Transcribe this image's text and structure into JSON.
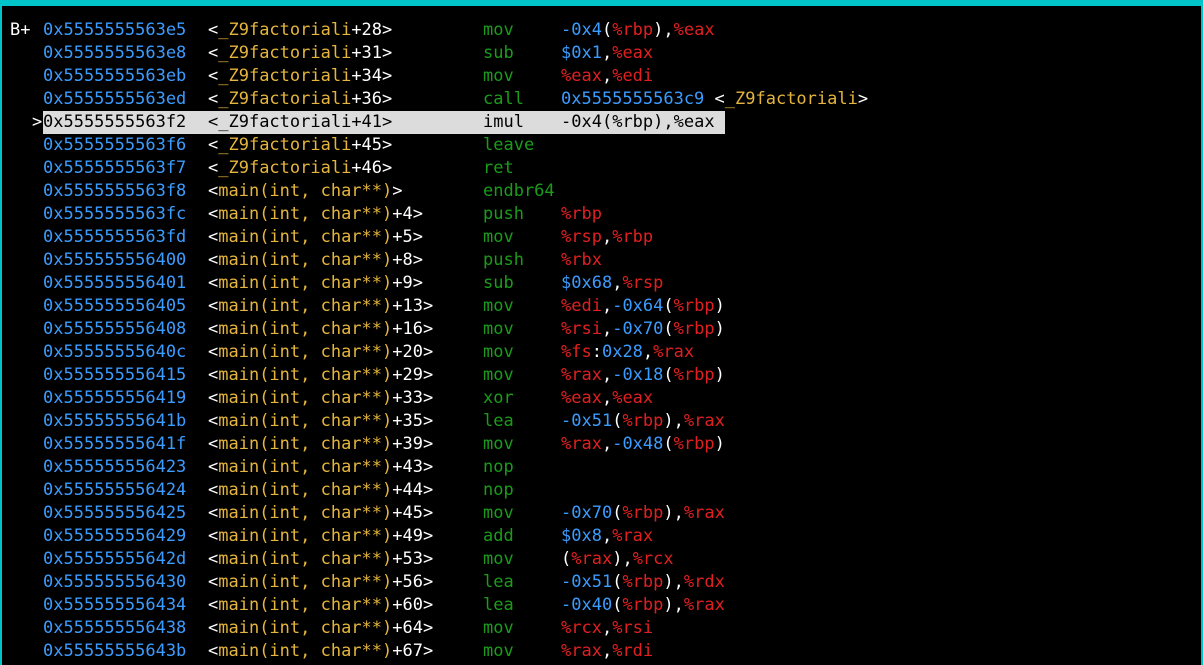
{
  "window": {
    "title": "",
    "border_color": "#00c5c8",
    "background": "#000000"
  },
  "colors": {
    "address": "#3b9cff",
    "symbol": "#e5b53d",
    "mnemonic": "#1a9c1a",
    "register": "#e02020",
    "immediate": "#3b9cff",
    "highlight_bg": "#dcdcdc"
  },
  "lines": [
    {
      "marker": "B+",
      "addr": "0x5555555563e5",
      "sym": "_Z9factoriali",
      "off": "+28",
      "mn": "mov",
      "ops": [
        [
          "-0x4",
          "num"
        ],
        [
          "(",
          "pun"
        ],
        [
          "%rbp",
          "reg"
        ],
        [
          "),",
          "pun"
        ],
        [
          "%eax",
          "reg"
        ]
      ]
    },
    {
      "marker": "",
      "addr": "0x5555555563e8",
      "sym": "_Z9factoriali",
      "off": "+31",
      "mn": "sub",
      "ops": [
        [
          "$0x1",
          "num"
        ],
        [
          ",",
          "pun"
        ],
        [
          "%eax",
          "reg"
        ]
      ]
    },
    {
      "marker": "",
      "addr": "0x5555555563eb",
      "sym": "_Z9factoriali",
      "off": "+34",
      "mn": "mov",
      "ops": [
        [
          "%eax",
          "reg"
        ],
        [
          ",",
          "pun"
        ],
        [
          "%edi",
          "reg"
        ]
      ]
    },
    {
      "marker": "",
      "addr": "0x5555555563ed",
      "sym": "_Z9factoriali",
      "off": "+36",
      "mn": "call",
      "ops": [
        [
          "0x5555555563c9",
          "num"
        ],
        [
          " <",
          "pun"
        ],
        [
          "_Z9factoriali",
          "sym"
        ],
        [
          ">",
          "pun"
        ]
      ]
    },
    {
      "marker": ">",
      "addr": "0x5555555563f2",
      "sym": "_Z9factoriali",
      "off": "+41",
      "mn": "imul",
      "current": true,
      "ops": [
        [
          "-0x4",
          "num"
        ],
        [
          "(",
          "pun"
        ],
        [
          "%rbp",
          "reg"
        ],
        [
          "),",
          "pun"
        ],
        [
          "%eax",
          "reg"
        ]
      ]
    },
    {
      "marker": "",
      "addr": "0x5555555563f6",
      "sym": "_Z9factoriali",
      "off": "+45",
      "mn": "leave",
      "ops": []
    },
    {
      "marker": "",
      "addr": "0x5555555563f7",
      "sym": "_Z9factoriali",
      "off": "+46",
      "mn": "ret",
      "ops": []
    },
    {
      "marker": "",
      "addr": "0x5555555563f8",
      "sym": "main(int, char**)",
      "off": "",
      "mn": "endbr64",
      "ops": []
    },
    {
      "marker": "",
      "addr": "0x5555555563fc",
      "sym": "main(int, char**)",
      "off": "+4",
      "mn": "push",
      "ops": [
        [
          "%rbp",
          "reg"
        ]
      ]
    },
    {
      "marker": "",
      "addr": "0x5555555563fd",
      "sym": "main(int, char**)",
      "off": "+5",
      "mn": "mov",
      "ops": [
        [
          "%rsp",
          "reg"
        ],
        [
          ",",
          "pun"
        ],
        [
          "%rbp",
          "reg"
        ]
      ]
    },
    {
      "marker": "",
      "addr": "0x555555556400",
      "sym": "main(int, char**)",
      "off": "+8",
      "mn": "push",
      "ops": [
        [
          "%rbx",
          "reg"
        ]
      ]
    },
    {
      "marker": "",
      "addr": "0x555555556401",
      "sym": "main(int, char**)",
      "off": "+9",
      "mn": "sub",
      "ops": [
        [
          "$0x68",
          "num"
        ],
        [
          ",",
          "pun"
        ],
        [
          "%rsp",
          "reg"
        ]
      ]
    },
    {
      "marker": "",
      "addr": "0x555555556405",
      "sym": "main(int, char**)",
      "off": "+13",
      "mn": "mov",
      "ops": [
        [
          "%edi",
          "reg"
        ],
        [
          ",",
          "pun"
        ],
        [
          "-0x64",
          "num"
        ],
        [
          "(",
          "pun"
        ],
        [
          "%rbp",
          "reg"
        ],
        [
          ")",
          "pun"
        ]
      ]
    },
    {
      "marker": "",
      "addr": "0x555555556408",
      "sym": "main(int, char**)",
      "off": "+16",
      "mn": "mov",
      "ops": [
        [
          "%rsi",
          "reg"
        ],
        [
          ",",
          "pun"
        ],
        [
          "-0x70",
          "num"
        ],
        [
          "(",
          "pun"
        ],
        [
          "%rbp",
          "reg"
        ],
        [
          ")",
          "pun"
        ]
      ]
    },
    {
      "marker": "",
      "addr": "0x55555555640c",
      "sym": "main(int, char**)",
      "off": "+20",
      "mn": "mov",
      "ops": [
        [
          "%fs",
          "reg"
        ],
        [
          ":",
          "pun"
        ],
        [
          "0x28",
          "num"
        ],
        [
          ",",
          "pun"
        ],
        [
          "%rax",
          "reg"
        ]
      ]
    },
    {
      "marker": "",
      "addr": "0x555555556415",
      "sym": "main(int, char**)",
      "off": "+29",
      "mn": "mov",
      "ops": [
        [
          "%rax",
          "reg"
        ],
        [
          ",",
          "pun"
        ],
        [
          "-0x18",
          "num"
        ],
        [
          "(",
          "pun"
        ],
        [
          "%rbp",
          "reg"
        ],
        [
          ")",
          "pun"
        ]
      ]
    },
    {
      "marker": "",
      "addr": "0x555555556419",
      "sym": "main(int, char**)",
      "off": "+33",
      "mn": "xor",
      "ops": [
        [
          "%eax",
          "reg"
        ],
        [
          ",",
          "pun"
        ],
        [
          "%eax",
          "reg"
        ]
      ]
    },
    {
      "marker": "",
      "addr": "0x55555555641b",
      "sym": "main(int, char**)",
      "off": "+35",
      "mn": "lea",
      "ops": [
        [
          "-0x51",
          "num"
        ],
        [
          "(",
          "pun"
        ],
        [
          "%rbp",
          "reg"
        ],
        [
          "),",
          "pun"
        ],
        [
          "%rax",
          "reg"
        ]
      ]
    },
    {
      "marker": "",
      "addr": "0x55555555641f",
      "sym": "main(int, char**)",
      "off": "+39",
      "mn": "mov",
      "ops": [
        [
          "%rax",
          "reg"
        ],
        [
          ",",
          "pun"
        ],
        [
          "-0x48",
          "num"
        ],
        [
          "(",
          "pun"
        ],
        [
          "%rbp",
          "reg"
        ],
        [
          ")",
          "pun"
        ]
      ]
    },
    {
      "marker": "",
      "addr": "0x555555556423",
      "sym": "main(int, char**)",
      "off": "+43",
      "mn": "nop",
      "ops": []
    },
    {
      "marker": "",
      "addr": "0x555555556424",
      "sym": "main(int, char**)",
      "off": "+44",
      "mn": "nop",
      "ops": []
    },
    {
      "marker": "",
      "addr": "0x555555556425",
      "sym": "main(int, char**)",
      "off": "+45",
      "mn": "mov",
      "ops": [
        [
          "-0x70",
          "num"
        ],
        [
          "(",
          "pun"
        ],
        [
          "%rbp",
          "reg"
        ],
        [
          "),",
          "pun"
        ],
        [
          "%rax",
          "reg"
        ]
      ]
    },
    {
      "marker": "",
      "addr": "0x555555556429",
      "sym": "main(int, char**)",
      "off": "+49",
      "mn": "add",
      "ops": [
        [
          "$0x8",
          "num"
        ],
        [
          ",",
          "pun"
        ],
        [
          "%rax",
          "reg"
        ]
      ]
    },
    {
      "marker": "",
      "addr": "0x55555555642d",
      "sym": "main(int, char**)",
      "off": "+53",
      "mn": "mov",
      "ops": [
        [
          "(",
          "pun"
        ],
        [
          "%rax",
          "reg"
        ],
        [
          "),",
          "pun"
        ],
        [
          "%rcx",
          "reg"
        ]
      ]
    },
    {
      "marker": "",
      "addr": "0x555555556430",
      "sym": "main(int, char**)",
      "off": "+56",
      "mn": "lea",
      "ops": [
        [
          "-0x51",
          "num"
        ],
        [
          "(",
          "pun"
        ],
        [
          "%rbp",
          "reg"
        ],
        [
          "),",
          "pun"
        ],
        [
          "%rdx",
          "reg"
        ]
      ]
    },
    {
      "marker": "",
      "addr": "0x555555556434",
      "sym": "main(int, char**)",
      "off": "+60",
      "mn": "lea",
      "ops": [
        [
          "-0x40",
          "num"
        ],
        [
          "(",
          "pun"
        ],
        [
          "%rbp",
          "reg"
        ],
        [
          "),",
          "pun"
        ],
        [
          "%rax",
          "reg"
        ]
      ]
    },
    {
      "marker": "",
      "addr": "0x555555556438",
      "sym": "main(int, char**)",
      "off": "+64",
      "mn": "mov",
      "ops": [
        [
          "%rcx",
          "reg"
        ],
        [
          ",",
          "pun"
        ],
        [
          "%rsi",
          "reg"
        ]
      ]
    },
    {
      "marker": "",
      "addr": "0x55555555643b",
      "sym": "main(int, char**)",
      "off": "+67",
      "mn": "mov",
      "ops": [
        [
          "%rax",
          "reg"
        ],
        [
          ",",
          "pun"
        ],
        [
          "%rdi",
          "reg"
        ]
      ]
    }
  ]
}
